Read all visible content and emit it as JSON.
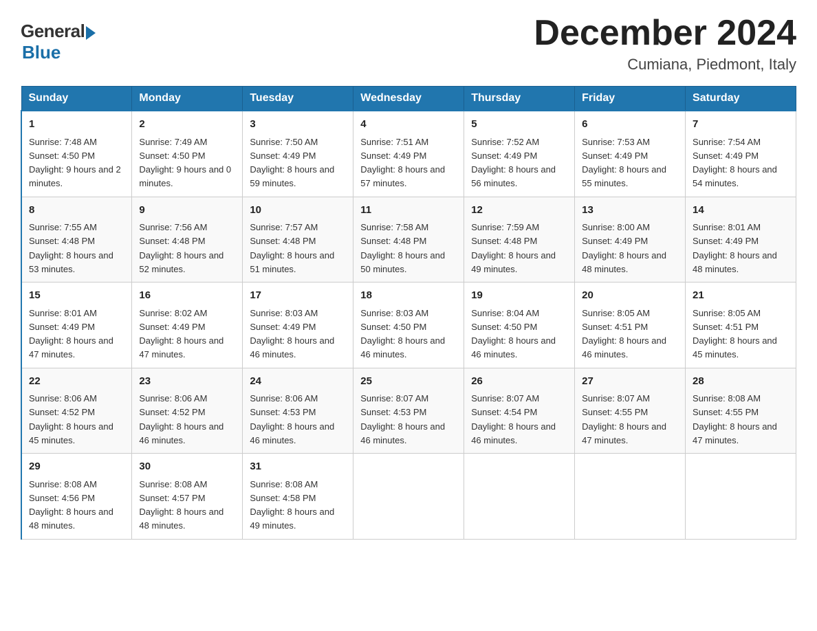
{
  "logo": {
    "general": "General",
    "blue": "Blue"
  },
  "title": {
    "month": "December 2024",
    "location": "Cumiana, Piedmont, Italy"
  },
  "days_header": [
    "Sunday",
    "Monday",
    "Tuesday",
    "Wednesday",
    "Thursday",
    "Friday",
    "Saturday"
  ],
  "weeks": [
    [
      {
        "num": "1",
        "sunrise": "7:48 AM",
        "sunset": "4:50 PM",
        "daylight": "9 hours and 2 minutes."
      },
      {
        "num": "2",
        "sunrise": "7:49 AM",
        "sunset": "4:50 PM",
        "daylight": "9 hours and 0 minutes."
      },
      {
        "num": "3",
        "sunrise": "7:50 AM",
        "sunset": "4:49 PM",
        "daylight": "8 hours and 59 minutes."
      },
      {
        "num": "4",
        "sunrise": "7:51 AM",
        "sunset": "4:49 PM",
        "daylight": "8 hours and 57 minutes."
      },
      {
        "num": "5",
        "sunrise": "7:52 AM",
        "sunset": "4:49 PM",
        "daylight": "8 hours and 56 minutes."
      },
      {
        "num": "6",
        "sunrise": "7:53 AM",
        "sunset": "4:49 PM",
        "daylight": "8 hours and 55 minutes."
      },
      {
        "num": "7",
        "sunrise": "7:54 AM",
        "sunset": "4:49 PM",
        "daylight": "8 hours and 54 minutes."
      }
    ],
    [
      {
        "num": "8",
        "sunrise": "7:55 AM",
        "sunset": "4:48 PM",
        "daylight": "8 hours and 53 minutes."
      },
      {
        "num": "9",
        "sunrise": "7:56 AM",
        "sunset": "4:48 PM",
        "daylight": "8 hours and 52 minutes."
      },
      {
        "num": "10",
        "sunrise": "7:57 AM",
        "sunset": "4:48 PM",
        "daylight": "8 hours and 51 minutes."
      },
      {
        "num": "11",
        "sunrise": "7:58 AM",
        "sunset": "4:48 PM",
        "daylight": "8 hours and 50 minutes."
      },
      {
        "num": "12",
        "sunrise": "7:59 AM",
        "sunset": "4:48 PM",
        "daylight": "8 hours and 49 minutes."
      },
      {
        "num": "13",
        "sunrise": "8:00 AM",
        "sunset": "4:49 PM",
        "daylight": "8 hours and 48 minutes."
      },
      {
        "num": "14",
        "sunrise": "8:01 AM",
        "sunset": "4:49 PM",
        "daylight": "8 hours and 48 minutes."
      }
    ],
    [
      {
        "num": "15",
        "sunrise": "8:01 AM",
        "sunset": "4:49 PM",
        "daylight": "8 hours and 47 minutes."
      },
      {
        "num": "16",
        "sunrise": "8:02 AM",
        "sunset": "4:49 PM",
        "daylight": "8 hours and 47 minutes."
      },
      {
        "num": "17",
        "sunrise": "8:03 AM",
        "sunset": "4:49 PM",
        "daylight": "8 hours and 46 minutes."
      },
      {
        "num": "18",
        "sunrise": "8:03 AM",
        "sunset": "4:50 PM",
        "daylight": "8 hours and 46 minutes."
      },
      {
        "num": "19",
        "sunrise": "8:04 AM",
        "sunset": "4:50 PM",
        "daylight": "8 hours and 46 minutes."
      },
      {
        "num": "20",
        "sunrise": "8:05 AM",
        "sunset": "4:51 PM",
        "daylight": "8 hours and 46 minutes."
      },
      {
        "num": "21",
        "sunrise": "8:05 AM",
        "sunset": "4:51 PM",
        "daylight": "8 hours and 45 minutes."
      }
    ],
    [
      {
        "num": "22",
        "sunrise": "8:06 AM",
        "sunset": "4:52 PM",
        "daylight": "8 hours and 45 minutes."
      },
      {
        "num": "23",
        "sunrise": "8:06 AM",
        "sunset": "4:52 PM",
        "daylight": "8 hours and 46 minutes."
      },
      {
        "num": "24",
        "sunrise": "8:06 AM",
        "sunset": "4:53 PM",
        "daylight": "8 hours and 46 minutes."
      },
      {
        "num": "25",
        "sunrise": "8:07 AM",
        "sunset": "4:53 PM",
        "daylight": "8 hours and 46 minutes."
      },
      {
        "num": "26",
        "sunrise": "8:07 AM",
        "sunset": "4:54 PM",
        "daylight": "8 hours and 46 minutes."
      },
      {
        "num": "27",
        "sunrise": "8:07 AM",
        "sunset": "4:55 PM",
        "daylight": "8 hours and 47 minutes."
      },
      {
        "num": "28",
        "sunrise": "8:08 AM",
        "sunset": "4:55 PM",
        "daylight": "8 hours and 47 minutes."
      }
    ],
    [
      {
        "num": "29",
        "sunrise": "8:08 AM",
        "sunset": "4:56 PM",
        "daylight": "8 hours and 48 minutes."
      },
      {
        "num": "30",
        "sunrise": "8:08 AM",
        "sunset": "4:57 PM",
        "daylight": "8 hours and 48 minutes."
      },
      {
        "num": "31",
        "sunrise": "8:08 AM",
        "sunset": "4:58 PM",
        "daylight": "8 hours and 49 minutes."
      },
      null,
      null,
      null,
      null
    ]
  ]
}
